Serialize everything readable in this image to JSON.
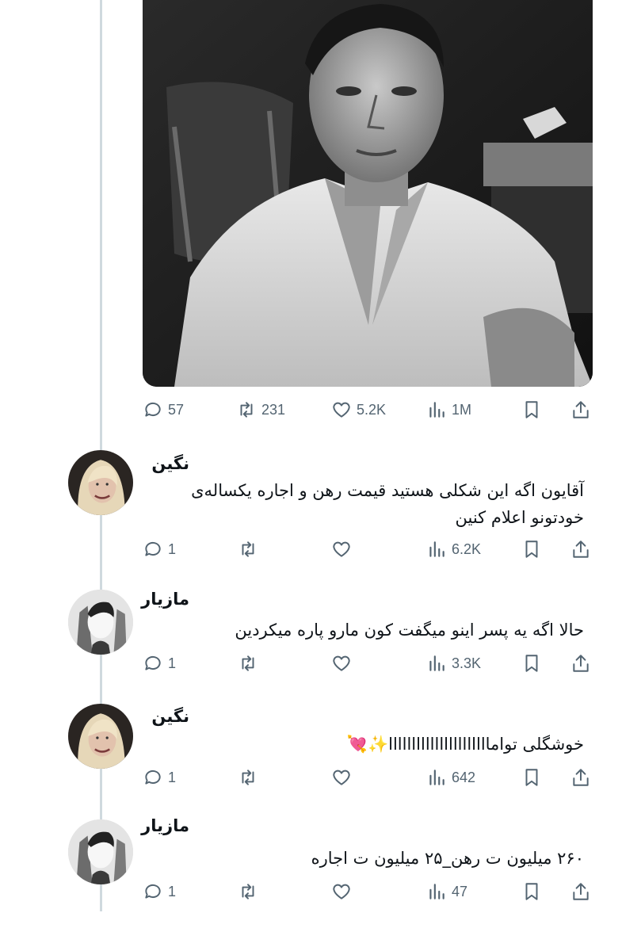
{
  "main_tweet": {
    "replies": "57",
    "retweets": "231",
    "likes": "5.2K",
    "views": "1M"
  },
  "replies": [
    {
      "author": "نگین",
      "text": "آقایون اگه این شکلی هستید قیمت رهن و اجاره یکساله‌ی خودتونو اعلام کنین",
      "reply_count": "1",
      "views": "6.2K",
      "avatar": "blonde-woman-avatar"
    },
    {
      "author": "مازیار",
      "text": "حالا اگه یه پسر اینو میگفت کون مارو پاره میکردین",
      "reply_count": "1",
      "views": "3.3K",
      "avatar": "masked-face-avatar"
    },
    {
      "author": "نگین",
      "text": "خوشگلی تواماااااااااااااااااااااا✨💘",
      "reply_count": "1",
      "views": "642",
      "avatar": "blonde-woman-avatar"
    },
    {
      "author": "مازیار",
      "text": "۲۶۰ میلیون ت رهن_۲۵ میلیون ت اجاره",
      "reply_count": "1",
      "views": "47",
      "avatar": "masked-face-avatar"
    }
  ],
  "icons": {
    "reply": "speech-bubble-icon",
    "retweet": "retweet-arrows-icon",
    "like": "heart-icon",
    "views": "bar-chart-icon",
    "bookmark": "bookmark-icon",
    "share": "share-upload-icon"
  },
  "colors": {
    "icon_gray": "#536471",
    "thread_line": "#cfd9de",
    "text": "#0f1419"
  }
}
